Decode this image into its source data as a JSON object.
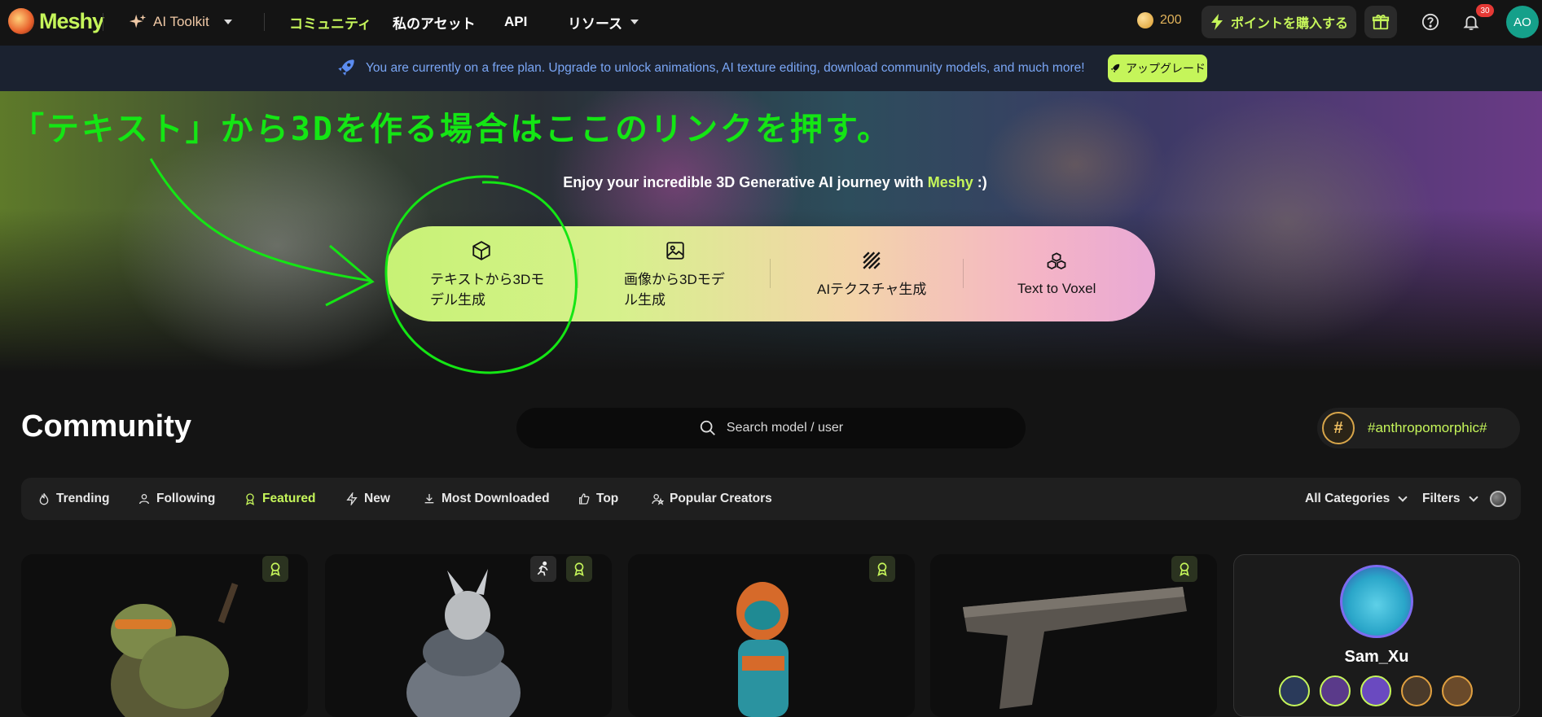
{
  "nav": {
    "logo": "Meshy",
    "ai_toolkit": "AI Toolkit",
    "community": "コミュニティ",
    "my_assets": "私のアセット",
    "api": "API",
    "resources": "リソース",
    "credits": "200",
    "buy_points": "ポイントを購入する",
    "notifications_count": "30",
    "avatar_initials": "AO"
  },
  "banner": {
    "text": "You are currently on a free plan. Upgrade to unlock animations, AI texture editing, download community models, and much more!",
    "upgrade": "アップグレード"
  },
  "annotation": {
    "text": "「テキスト」から3Dを作る場合はここのリンクを押す。"
  },
  "hero": {
    "line_pre": "Enjoy your incredible 3D Generative AI journey with ",
    "brand": "Meshy",
    "line_post": " :)",
    "options": [
      {
        "icon": "cube-icon",
        "label_line1": "テキストから3Dモ",
        "label_line2": "デル生成"
      },
      {
        "icon": "image-icon",
        "label_line1": "画像から3Dモデ",
        "label_line2": "ル生成"
      },
      {
        "icon": "texture-icon",
        "label_line1": "AIテクスチャ生成",
        "label_line2": ""
      },
      {
        "icon": "voxel-icon",
        "label_line1": "Text to Voxel",
        "label_line2": ""
      }
    ]
  },
  "community": {
    "title": "Community",
    "search_placeholder": "Search model / user",
    "tag": "#anthropomorphic#",
    "filters": [
      "Trending",
      "Following",
      "Featured",
      "New",
      "Most Downloaded",
      "Top",
      "Popular Creators"
    ],
    "active_filter": "Featured",
    "categories": "All Categories",
    "filters_label": "Filters"
  },
  "creator": {
    "name": "Sam_Xu"
  },
  "colors": {
    "accent": "#c5f55a",
    "annotation": "#14e614",
    "banner_text": "#7aa6f5"
  }
}
